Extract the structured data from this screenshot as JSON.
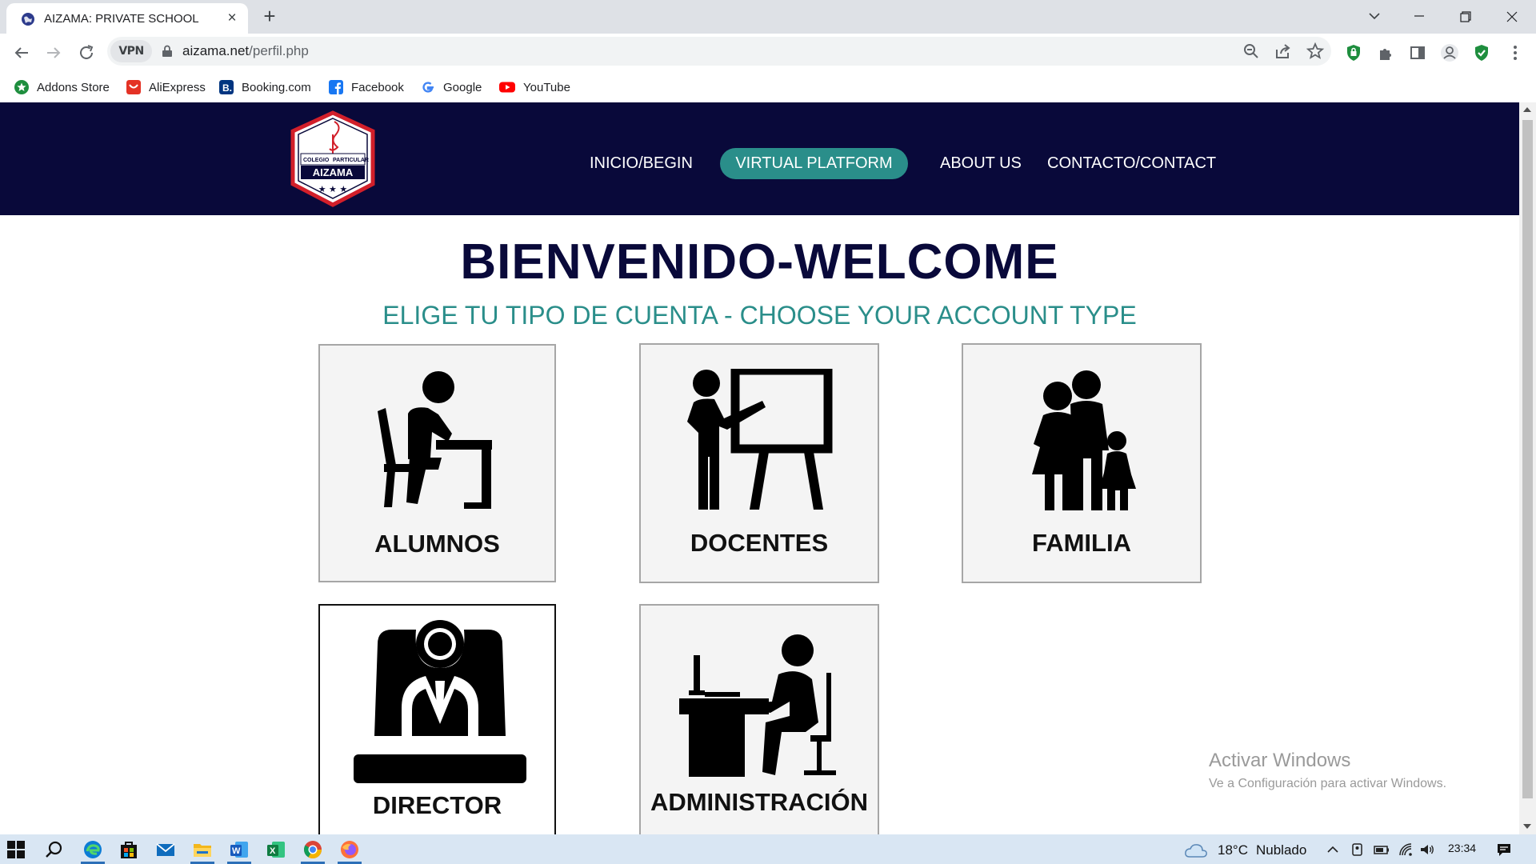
{
  "browser": {
    "tab_title": "AIZAMA: PRIVATE SCHOOL",
    "tab_close": "×",
    "new_tab": "+",
    "vpn_label": "VPN",
    "url_host": "aizama.net",
    "url_path": "/perfil.php",
    "bookmarks": [
      {
        "label": "Addons Store",
        "icon": "addons-store-icon",
        "color": "#1e8e3e"
      },
      {
        "label": "AliExpress",
        "icon": "aliexpress-icon",
        "color": "#e43225"
      },
      {
        "label": "Booking.com",
        "icon": "booking-icon",
        "color": "#003580"
      },
      {
        "label": "Facebook",
        "icon": "facebook-icon",
        "color": "#1877f2"
      },
      {
        "label": "Google",
        "icon": "google-icon",
        "color": "#4285f4"
      },
      {
        "label": "YouTube",
        "icon": "youtube-icon",
        "color": "#ff0000"
      }
    ]
  },
  "site": {
    "logo": {
      "line1": "COLEGIO",
      "line2": "PARTICULAR",
      "name": "AIZAMA"
    },
    "nav": {
      "home": "INICIO/BEGIN",
      "virtual": "VIRTUAL PLATFORM",
      "about": "ABOUT US",
      "contact": "CONTACTO/CONTACT"
    },
    "title": "BIENVENIDO-WELCOME",
    "subtitle": "ELIGE TU TIPO DE CUENTA - CHOOSE YOUR ACCOUNT TYPE",
    "cards": [
      {
        "label": "ALUMNOS",
        "icon": "student-icon"
      },
      {
        "label": "DOCENTES",
        "icon": "teacher-icon"
      },
      {
        "label": "FAMILIA",
        "icon": "family-icon"
      },
      {
        "label": "DIRECTOR",
        "icon": "director-icon"
      },
      {
        "label": "ADMINISTRACIÓN",
        "icon": "office-worker-icon"
      }
    ],
    "colors": {
      "header_bg": "#09093a",
      "accent": "#2a8e8a",
      "title": "#09093a"
    }
  },
  "watermark": {
    "title": "Activar Windows",
    "subtitle": "Ve a Configuración para activar Windows."
  },
  "taskbar": {
    "temperature": "18°C",
    "weather": "Nublado",
    "time": "23:34"
  }
}
